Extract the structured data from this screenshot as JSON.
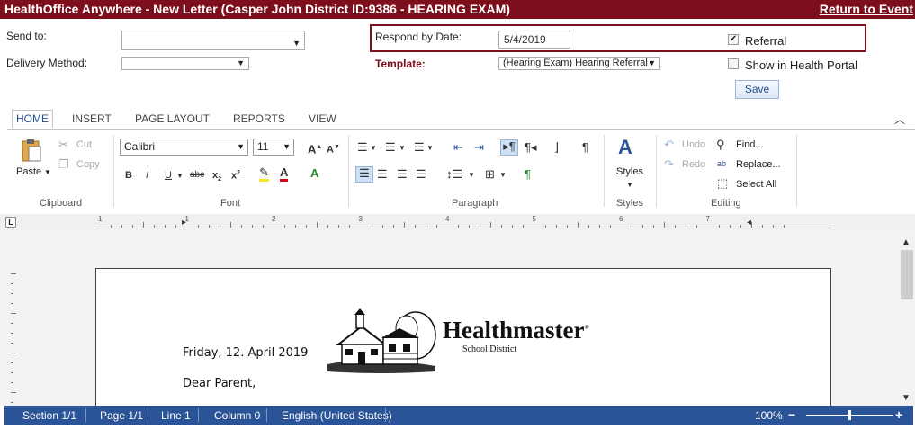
{
  "window": {
    "title": "HealthOffice Anywhere - New Letter (Casper John District ID:9386 - HEARING EXAM)",
    "return_link": "Return to Event"
  },
  "form": {
    "send_to_label": "Send to:",
    "send_to_value": "",
    "delivery_label": "Delivery Method:",
    "delivery_value": "",
    "respond_label": "Respond by Date:",
    "respond_value": "5/4/2019",
    "referral_label": "Referral",
    "referral_checked": true,
    "template_label": "Template:",
    "template_value": "(Hearing Exam) Hearing Referral",
    "portal_label": "Show in Health Portal",
    "portal_checked": false,
    "save_label": "Save"
  },
  "ribbon": {
    "tabs": [
      {
        "label": "HOME",
        "active": true
      },
      {
        "label": "INSERT"
      },
      {
        "label": "PAGE LAYOUT"
      },
      {
        "label": "REPORTS"
      },
      {
        "label": "VIEW"
      }
    ],
    "clipboard": {
      "paste": "Paste",
      "cut": "Cut",
      "copy": "Copy",
      "group": "Clipboard"
    },
    "font": {
      "family": "Calibri",
      "size": "11",
      "group": "Font"
    },
    "paragraph": {
      "group": "Paragraph"
    },
    "styles": {
      "label": "Styles",
      "group": "Styles"
    },
    "editing": {
      "undo": "Undo",
      "redo": "Redo",
      "find": "Find...",
      "replace": "Replace...",
      "select_all": "Select All",
      "group": "Editing"
    }
  },
  "ruler": {
    "numbers": [
      "1",
      "1",
      "2",
      "3",
      "4",
      "5",
      "6",
      "7"
    ]
  },
  "document": {
    "date_line": "Friday, 12. April 2019",
    "greeting": "Dear Parent,",
    "logo_name": "Healthmaster",
    "logo_sub": "School District",
    "logo_mark": "®"
  },
  "status": {
    "section": "Section 1/1",
    "page": "Page 1/1",
    "line": "Line 1",
    "column": "Column 0",
    "language": "English (United States)",
    "zoom": "100%",
    "zoom_out": "−",
    "zoom_in": "+"
  },
  "colors": {
    "title_bar": "#7d0e1b",
    "status_bar": "#2a5497",
    "highlight_yellow": "#f5e52a",
    "font_red": "#d0021b"
  }
}
